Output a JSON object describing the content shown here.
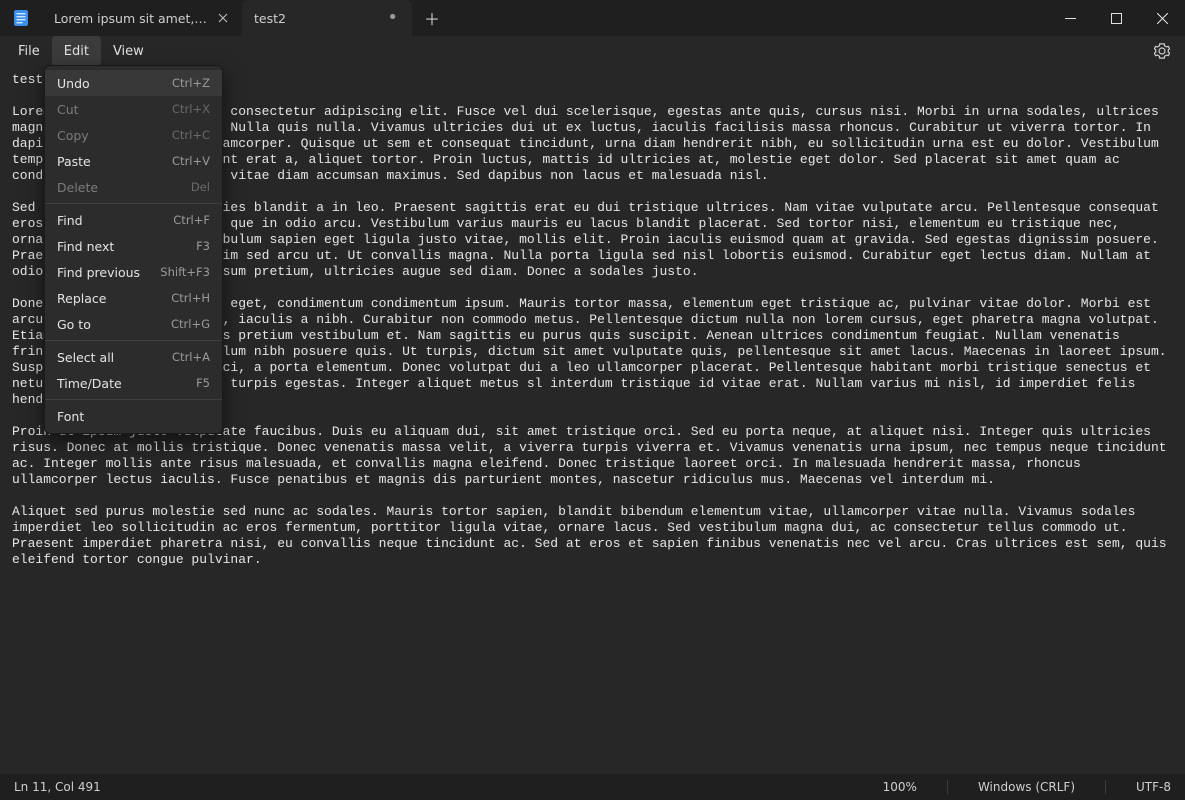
{
  "window": {
    "tabs": [
      {
        "label": "Lorem ipsum sit amet, consect",
        "dirty": false,
        "active": false
      },
      {
        "label": "test2",
        "dirty": true,
        "active": true
      }
    ]
  },
  "menubar": {
    "file": "File",
    "edit": "Edit",
    "view": "View"
  },
  "edit_menu": {
    "items": [
      {
        "label": "Undo",
        "shortcut": "Ctrl+Z",
        "disabled": false,
        "hover": true,
        "sep_after": false
      },
      {
        "label": "Cut",
        "shortcut": "Ctrl+X",
        "disabled": true,
        "hover": false,
        "sep_after": false
      },
      {
        "label": "Copy",
        "shortcut": "Ctrl+C",
        "disabled": true,
        "hover": false,
        "sep_after": false
      },
      {
        "label": "Paste",
        "shortcut": "Ctrl+V",
        "disabled": false,
        "hover": false,
        "sep_after": false
      },
      {
        "label": "Delete",
        "shortcut": "Del",
        "disabled": true,
        "hover": false,
        "sep_after": true
      },
      {
        "label": "Find",
        "shortcut": "Ctrl+F",
        "disabled": false,
        "hover": false,
        "sep_after": false
      },
      {
        "label": "Find next",
        "shortcut": "F3",
        "disabled": false,
        "hover": false,
        "sep_after": false
      },
      {
        "label": "Find previous",
        "shortcut": "Shift+F3",
        "disabled": false,
        "hover": false,
        "sep_after": false
      },
      {
        "label": "Replace",
        "shortcut": "Ctrl+H",
        "disabled": false,
        "hover": false,
        "sep_after": false
      },
      {
        "label": "Go to",
        "shortcut": "Ctrl+G",
        "disabled": false,
        "hover": false,
        "sep_after": true
      },
      {
        "label": "Select all",
        "shortcut": "Ctrl+A",
        "disabled": false,
        "hover": false,
        "sep_after": false
      },
      {
        "label": "Time/Date",
        "shortcut": "F5",
        "disabled": false,
        "hover": false,
        "sep_after": true
      },
      {
        "label": "Font",
        "shortcut": "",
        "disabled": false,
        "hover": false,
        "sep_after": false
      }
    ]
  },
  "document": {
    "visible_title": "test2",
    "body_text": "test2\n\nLorem ipsum dolor sit amet, consectetur adipiscing elit. Fusce vel dui scelerisque, egestas ante quis, cursus nisi. Morbi in urna sodales, ultrices magna vel, consequat risus. Nulla quis nulla. Vivamus ultricies dui ut ex luctus, iaculis facilisis massa rhoncus. Curabitur ut viverra tortor. In dapibus orci non cursus ullamcorper. Quisque ut sem et consequat tincidunt, urna diam hendrerit nibh, eu sollicitudin urna est eu dolor. Vestibulum tempus sem maximus, tincidunt erat a, aliquet tortor. Proin luctus, mattis id ultricies at, molestie eget dolor. Sed placerat sit amet quam ac condimentum. Etiam et augue vitae diam accumsan maximus. Sed dapibus non lacus et malesuada nisl.\n\nSed sit amet orci ac ultricies blandit a in leo. Praesent sagittis erat eu dui tristique ultrices. Nam vitae vulputate arcu. Pellentesque consequat eros eget ullamcorper augue que in odio arcu. Vestibulum varius mauris eu lacus blandit placerat. Sed tortor nisi, elementum eu tristique nec, ornare eu nunc. Etiam vestibulum sapien eget ligula justo vitae, mollis elit. Proin iaculis euismod quam at gravida. Sed egestas dignissim posuere. Praesent nisi eros, dignissim sed arcu ut. Ut convallis magna. Nulla porta ligula sed nisl lobortis euismod. Curabitur eget lectus diam. Nullam at odio nulla. Sed sit amet ipsum pretium, ultricies augue sed diam. Donec a sodales justo.\n\nDonec congue consequat orci eget, condimentum condimentum ipsum. Mauris tortor massa, elementum eget tristique ac, pulvinar vitae dolor. Morbi est arcu, consectetur eget purt, iaculis a nibh. Curabitur non commodo metus. Pellentesque dictum nulla non lorem cursus, eget pharetra magna volutpat. Etiam posuere nunc et lectus pretium vestibulum et. Nam sagittis eu purus quis suscipit. Aenean ultrices condimentum feugiat. Nullam venenatis fringilla justo, ac vestibulum nibh posuere quis. Ut turpis, dictum sit amet vulputate quis, pellentesque sit amet lacus. Maecenas in laoreet ipsum. Suspendisse egestas nisi orci, a porta elementum. Donec volutpat dui a leo ullamcorper placerat. Pellentesque habitant morbi tristique senectus et netus et malesuada fames ac turpis egestas. Integer aliquet metus sl interdum tristique id vitae erat. Nullam varius mi nisl, id imperdiet felis hendrerit sed.\n\nProin ut ipsum justo vulputate faucibus. Duis eu aliquam dui, sit amet tristique orci. Sed eu porta neque, at aliquet nisi. Integer quis ultricies risus. Donec at mollis tristique. Donec venenatis massa velit, a viverra turpis viverra et. Vivamus venenatis urna ipsum, nec tempus neque tincidunt ac. Integer mollis ante risus malesuada, et convallis magna eleifend. Donec tristique laoreet orci. In malesuada hendrerit massa, rhoncus ullamcorper lectus iaculis. Fusce penatibus et magnis dis parturient montes, nascetur ridiculus mus. Maecenas vel interdum mi.\n\nAliquet sed purus molestie sed nunc ac sodales. Mauris tortor sapien, blandit bibendum elementum vitae, ullamcorper vitae nulla. Vivamus sodales imperdiet leo sollicitudin ac eros fermentum, porttitor ligula vitae, ornare lacus. Sed vestibulum magna dui, ac consectetur tellus commodo ut. Praesent imperdiet pharetra nisi, eu convallis neque tincidunt ac. Sed at eros et sapien finibus venenatis nec vel arcu. Cras ultrices est sem, quis eleifend tortor congue pulvinar."
  },
  "statusbar": {
    "position": "Ln 11, Col 491",
    "zoom": "100%",
    "line_endings": "Windows (CRLF)",
    "encoding": "UTF-8"
  }
}
